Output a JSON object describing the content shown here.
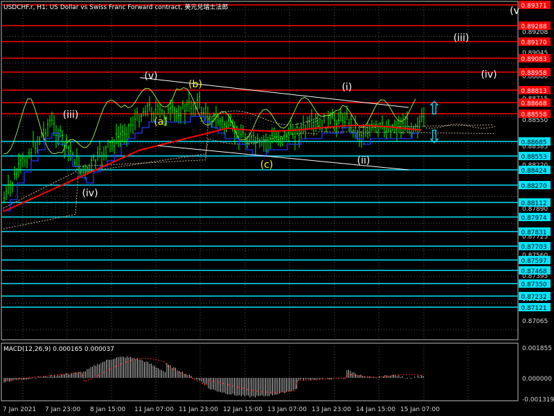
{
  "chart_title": "USDCHF.r, H1:  US Dollar vs Swiss Franc Forward contract, 美元兑瑞士法郎",
  "macd_label": "MACD(12,26,9) 0.000165 0.000037",
  "wave_labels_white": [
    "(v)",
    "(iii)",
    "(iv)",
    "(i)",
    "(ii)",
    "(iii)",
    "(iv)",
    "(v"
  ],
  "wave_labels_yellow": [
    "(a)",
    "(b)",
    "(c)"
  ],
  "arrows": {
    "up": "⇧",
    "down": "⇩"
  },
  "price_axis_ticks": [
    "0.89371",
    "0.89208",
    "0.89045",
    "0.88880",
    "0.88715",
    "0.88550",
    "0.88385",
    "0.88220",
    "0.88055",
    "0.87890",
    "0.87725",
    "0.87560",
    "0.87395",
    "0.87230",
    "0.87065"
  ],
  "red_level_labels": [
    "0.89371",
    "0.89288",
    "0.89170",
    "0.89083",
    "0.88958",
    "0.88813",
    "0.88668",
    "0.88558"
  ],
  "cyan_level_labels": [
    "0.88685",
    "0.88553",
    "0.88424",
    "0.88270",
    "0.88112",
    "0.87974",
    "0.87831",
    "0.87703",
    "0.87597",
    "0.87468",
    "0.87350",
    "0.87232",
    "0.87121"
  ],
  "macd_axis_ticks": [
    "0.001855",
    "0.000000",
    "-0.001319"
  ],
  "time_axis_ticks": [
    "7 Jan 2021",
    "7 Jan 23:00",
    "8 Jan 15:00",
    "11 Jan 07:00",
    "11 Jan 23:00",
    "12 Jan 15:00",
    "13 Jan 07:00",
    "13 Jan 23:00",
    "14 Jan 15:00",
    "15 Jan 07:00"
  ],
  "colors": {
    "background": "#000000",
    "grid": "#5a5a5a",
    "candles": "#00ff00",
    "red_levels": "#ff0000",
    "cyan_levels": "#00e5ff",
    "ema_red": "#ff0000",
    "ma_blue": "#1f3bff",
    "lag_line": "#9be34a",
    "trend_lines": "#ffffff",
    "labels_white": "#ffffff",
    "labels_yellow": "#ffff00",
    "cloud": "#c8b496",
    "macd_hist": "#c0c0c0",
    "macd_signal": "#ff2a2a"
  }
}
